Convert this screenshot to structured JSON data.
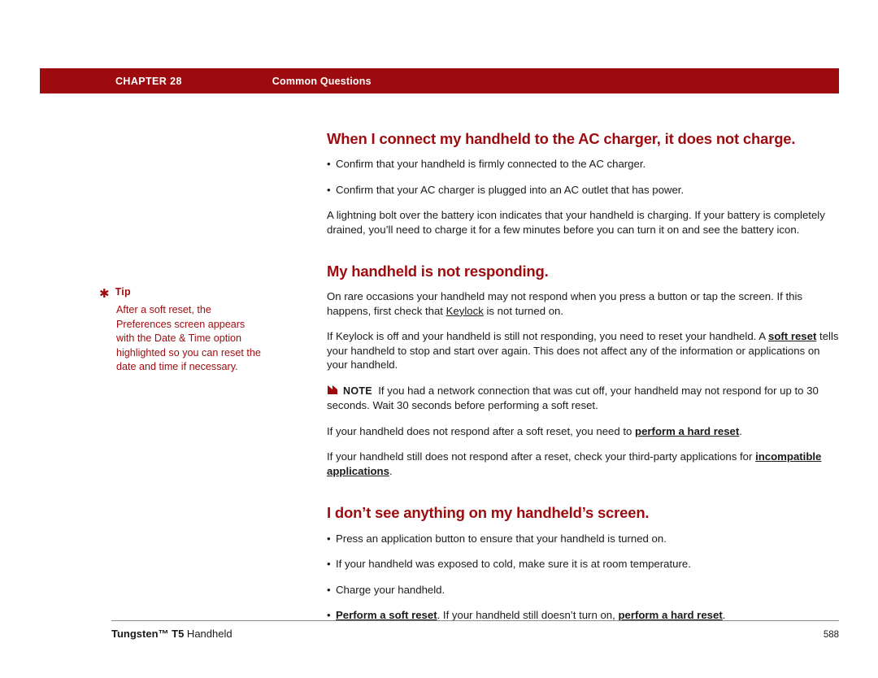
{
  "header": {
    "chapter": "CHAPTER 28",
    "section": "Common Questions"
  },
  "tip": {
    "label": "Tip",
    "icon": "asterisk-icon",
    "body": "After a soft reset, the Preferences screen appears with the Date & Time option highlighted so you can reset the date and time if necessary."
  },
  "main": {
    "heading1": "When I connect my handheld to the AC charger, it does not charge.",
    "bullet1": "Confirm that your handheld is firmly connected to the AC charger.",
    "bullet2": "Confirm that your AC charger is plugged into an AC outlet that has power.",
    "para1": "A lightning bolt over the battery icon indicates that your handheld is charging. If your battery is completely drained, you’ll need to charge it for a few minutes before you can turn it on and see the battery icon.",
    "heading2": "My handheld is not responding.",
    "para2_a": "On rare occasions your handheld may not respond when you press a button or tap the screen. If this happens, first check that ",
    "para2_link": "Keylock",
    "para2_b": " is not turned on.",
    "para3_a": "If Keylock is off and your handheld is still not responding, you need to reset your handheld. A ",
    "para3_link": "soft reset",
    "para3_b": " tells your handheld to stop and start over again. This does not affect any of the information or applications on your handheld.",
    "note_label": "NOTE",
    "note_text": "If you had a network connection that was cut off, your handheld may not respond for up to 30 seconds. Wait 30 seconds before performing a soft reset.",
    "para4_a": "If your handheld does not respond after a soft reset, you need to ",
    "para4_link": "perform a hard reset",
    "para4_b": ".",
    "para5_a": "If your handheld still does not respond after a reset, check your third-party applications for ",
    "para5_link": "incompatible applications",
    "para5_b": ".",
    "heading3": "I don’t see anything on my handheld’s screen.",
    "bullet3": "Press an application button to ensure that your handheld is turned on.",
    "bullet4": "If your handheld was exposed to cold, make sure it is at room temperature.",
    "bullet5": "Charge your handheld.",
    "bullet6_link1": "Perform a soft reset",
    "bullet6_mid": ". If your handheld still doesn’t turn on, ",
    "bullet6_link2": "perform a hard reset",
    "bullet6_end": "."
  },
  "footer": {
    "brand": "Tungsten™ T5",
    "product": " Handheld",
    "page": "588"
  },
  "colors": {
    "accent": "#9e0b0f",
    "text": "#1a1a1a"
  }
}
